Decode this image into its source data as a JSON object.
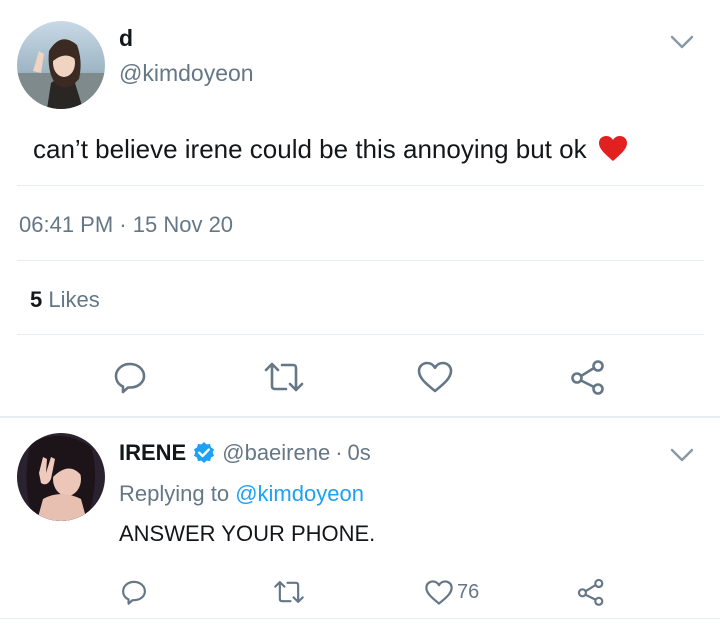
{
  "main_tweet": {
    "display_name": "d",
    "handle": "@kimdoyeon",
    "text": "can’t believe irene could be this annoying but ok",
    "emoji": "❤️",
    "time": "06:41 PM",
    "date_sep": "·",
    "date": "15 Nov 20",
    "likes_count": "5",
    "likes_label": "Likes",
    "actions": [
      "reply-icon",
      "retweet-icon",
      "like-icon",
      "share-icon"
    ]
  },
  "reply": {
    "display_name": "IRENE",
    "verified": true,
    "handle": "@baeirene",
    "sep": "·",
    "time_ago": "0s",
    "replying_prefix": "Replying to",
    "replying_to": "@kimdoyeon",
    "text": "ANSWER YOUR PHONE.",
    "like_count": "76",
    "actions": [
      "reply-icon",
      "retweet-icon",
      "like-icon",
      "share-icon"
    ]
  },
  "colors": {
    "text": "#14171a",
    "muted": "#657786",
    "link": "#1da1f2",
    "divider": "#e6ecf0",
    "heart": "#e0245e"
  }
}
